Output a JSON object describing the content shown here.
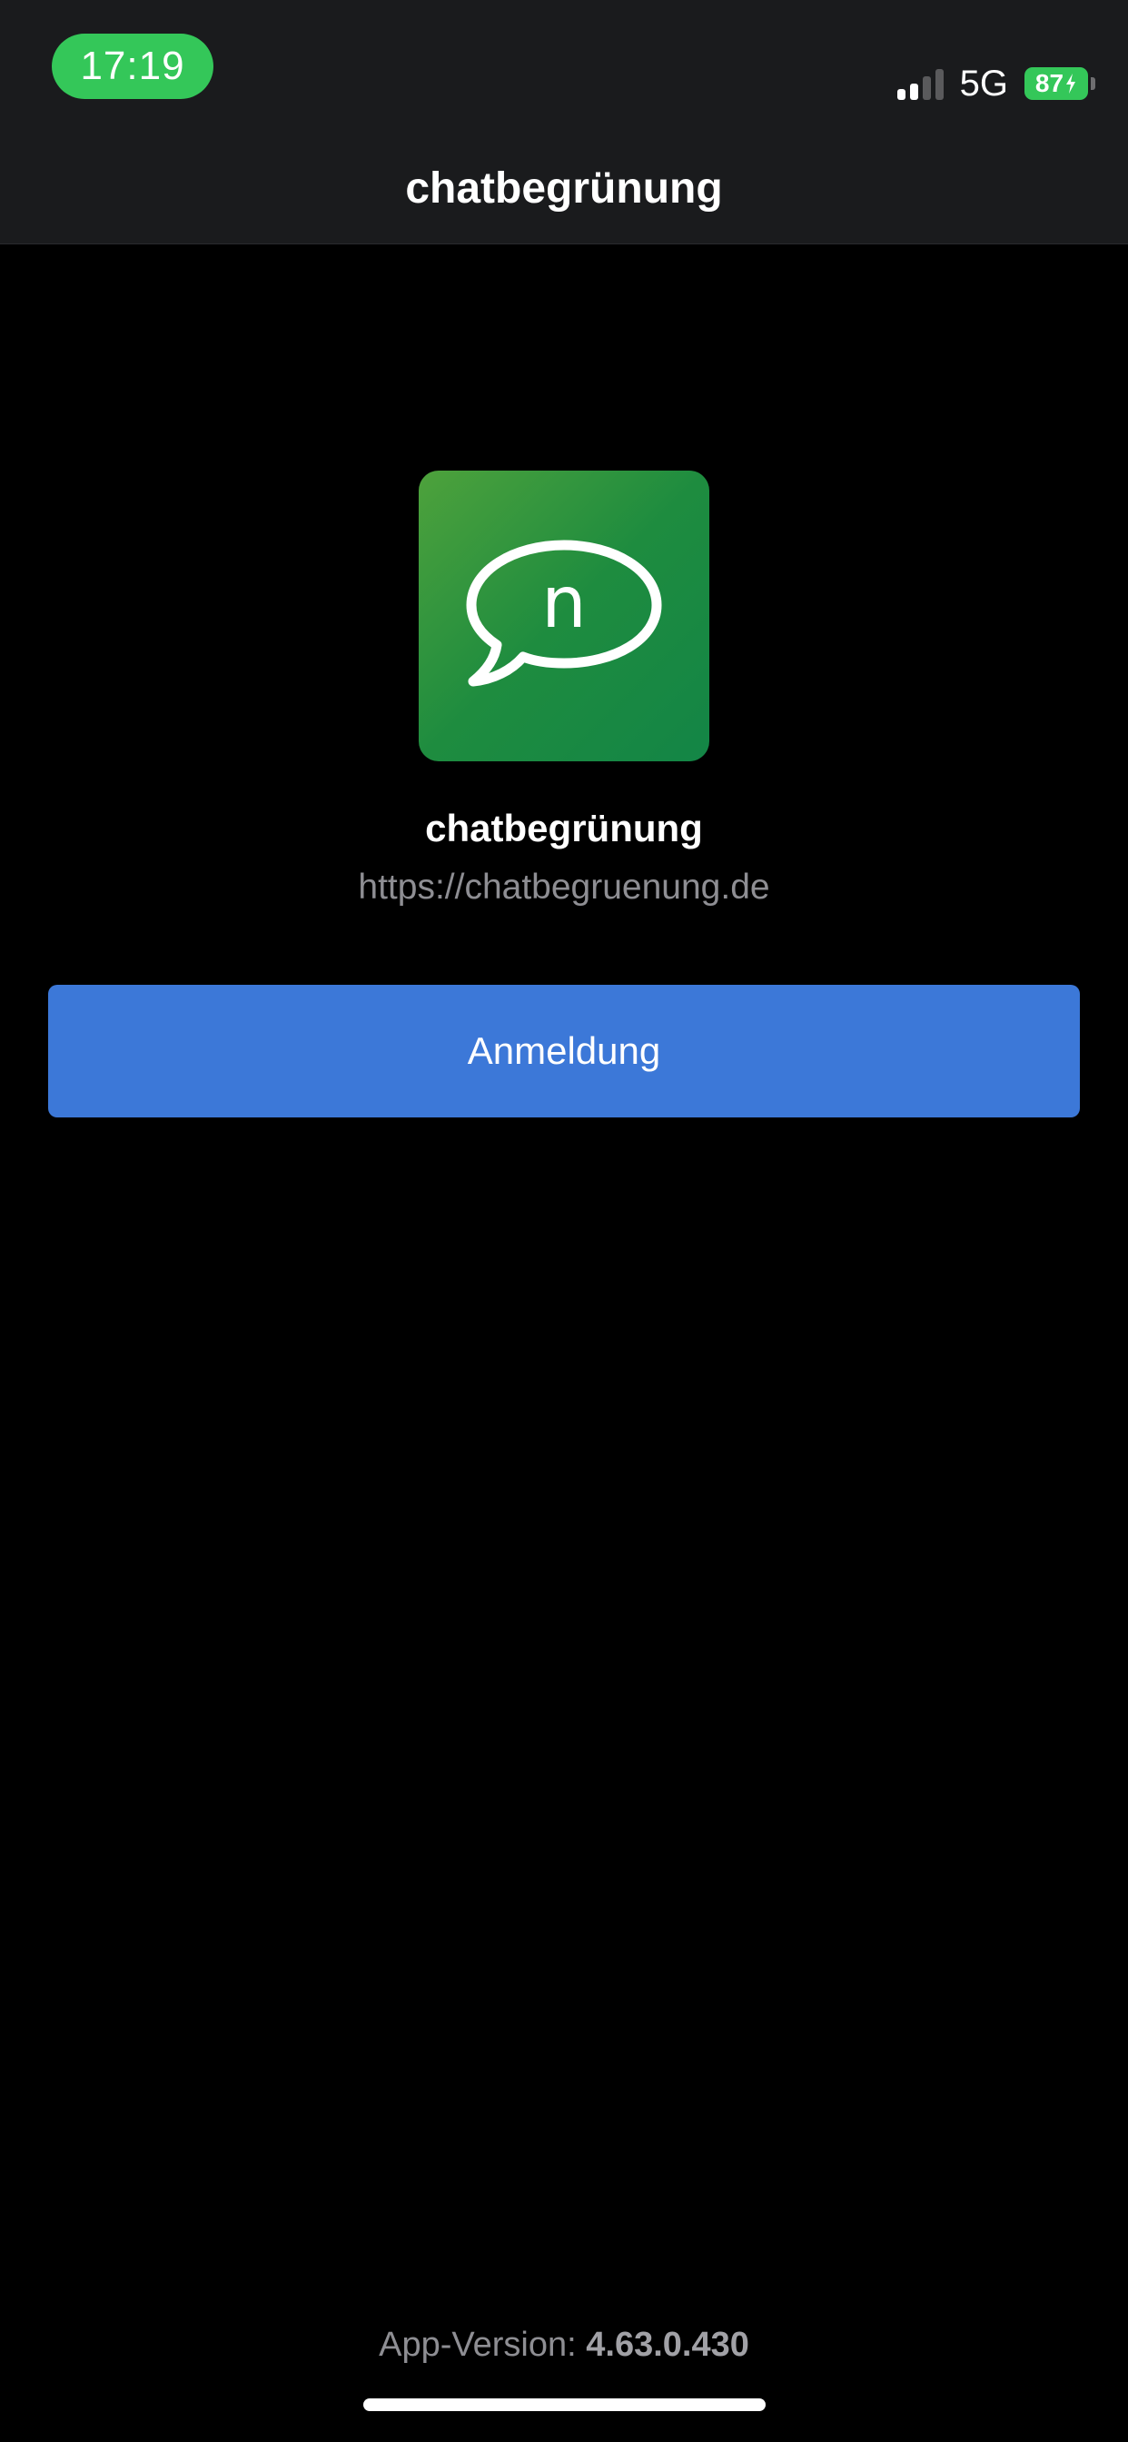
{
  "status_bar": {
    "time": "17:19",
    "network": "5G",
    "battery_percent": "87",
    "signal_bars_active": 2,
    "signal_bars_total": 4,
    "time_pill_color": "#34c759",
    "battery_color": "#34c759"
  },
  "nav": {
    "title": "chatbegrünung"
  },
  "app": {
    "logo_icon": "speech-bubble-n-icon",
    "logo_letter": "n",
    "name": "chatbegrünung",
    "url": "https://chatbegruenung.de"
  },
  "login": {
    "label": "Anmeldung",
    "color": "#3c78d8"
  },
  "footer": {
    "version_label": "App-Version:",
    "version_number": "4.63.0.430"
  }
}
